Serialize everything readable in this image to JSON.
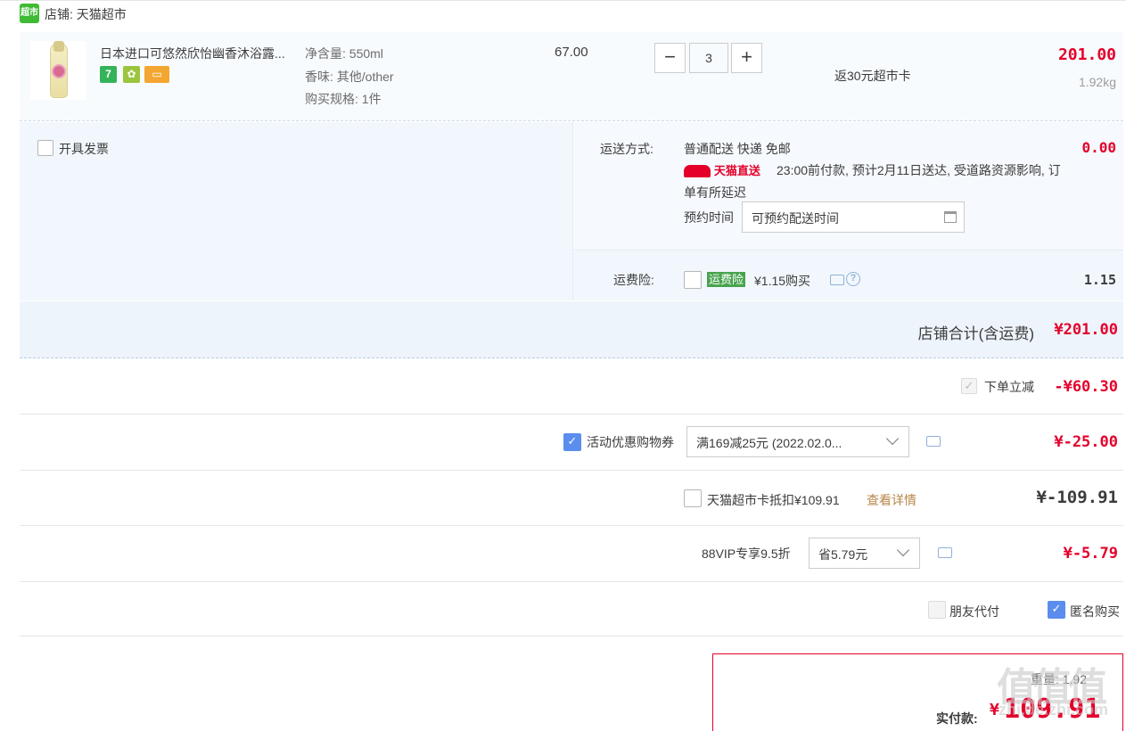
{
  "store": {
    "logo_text": "超市",
    "name": "店铺: 天猫超市"
  },
  "product": {
    "name": "日本进口可悠然欣怡幽香沐浴露...",
    "badges": [
      "7",
      "",
      ""
    ],
    "attrs": [
      "净含量: 550ml",
      "香味: 其他/other",
      "购买规格: 1件"
    ],
    "unit_price": "67.00",
    "qty_minus": "−",
    "qty": "3",
    "qty_plus": "+",
    "rebate": "返30元超市卡",
    "total": "201.00",
    "weight": "1.92kg"
  },
  "invoice": {
    "label": "开具发票"
  },
  "delivery": {
    "method_label": "运送方式:",
    "method_value": "普通配送 快递 免邮",
    "fee": "0.00",
    "tmall_direct": "天猫直送",
    "note_line1": "23:00前付款, 预计2月11日送达, 受道路资源影响, 订",
    "note_line2": "单有所延迟",
    "schedule_label": "预约时间",
    "schedule_placeholder": "可预约配送时间"
  },
  "insurance": {
    "label": "运费险:",
    "tag": "运费险",
    "desc": "¥1.15购买",
    "amount": "1.15"
  },
  "store_total": {
    "label": "店铺合计(含运费)",
    "value": "¥201.00"
  },
  "discounts": {
    "instant": {
      "label": "下单立减",
      "value": "-¥60.30"
    },
    "coupon": {
      "label": "活动优惠购物券",
      "selected": "满169减25元 (2022.02.0...",
      "value": "¥-25.00"
    },
    "card": {
      "label": "天猫超市卡抵扣¥109.91",
      "link": "查看详情",
      "value": "¥-109.91"
    },
    "vip": {
      "label": "88VIP专享9.5折",
      "selected": "省5.79元",
      "value": "¥-5.79"
    }
  },
  "options": {
    "friend_pay": "朋友代付",
    "anonymous": "匿名购买"
  },
  "pay": {
    "weight_label": "重量: 1.92",
    "actual_label": "实付款:",
    "currency": "¥",
    "amount": "109.91"
  },
  "watermark": {
    "glyphs": "值值值",
    "domain": "zhi.de.zhi.com"
  },
  "colors": {
    "accent_red": "#e4002b",
    "checkbox_blue": "#5b8def",
    "store_green": "#3fbb34",
    "insurance_green": "#48a44e"
  },
  "icons": [
    "calendar-icon",
    "message-icon",
    "help-icon",
    "chevron-down-icon"
  ]
}
